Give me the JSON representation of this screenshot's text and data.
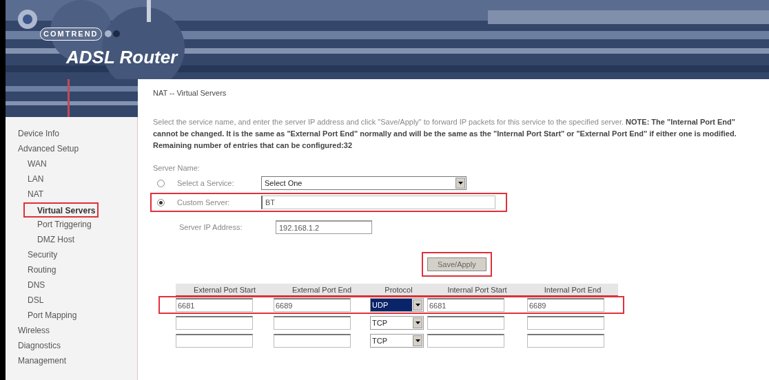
{
  "header": {
    "brand": "COMTREND",
    "product": "ADSL Router"
  },
  "sidebar": {
    "items": [
      {
        "label": "Device Info",
        "selected": false,
        "highlighted": false
      },
      {
        "label": "Advanced Setup",
        "selected": false,
        "highlighted": false,
        "children": [
          {
            "label": "WAN",
            "selected": false,
            "highlighted": false
          },
          {
            "label": "LAN",
            "selected": false,
            "highlighted": false
          },
          {
            "label": "NAT",
            "selected": false,
            "highlighted": false,
            "children": [
              {
                "label": "Virtual Servers",
                "selected": true,
                "highlighted": true
              },
              {
                "label": "Port Triggering",
                "selected": false,
                "highlighted": false
              },
              {
                "label": "DMZ Host",
                "selected": false,
                "highlighted": false
              }
            ]
          },
          {
            "label": "Security",
            "selected": false,
            "highlighted": false
          },
          {
            "label": "Routing",
            "selected": false,
            "highlighted": false
          },
          {
            "label": "DNS",
            "selected": false,
            "highlighted": false
          },
          {
            "label": "DSL",
            "selected": false,
            "highlighted": false
          },
          {
            "label": "Port Mapping",
            "selected": false,
            "highlighted": false
          }
        ]
      },
      {
        "label": "Wireless",
        "selected": false,
        "highlighted": false
      },
      {
        "label": "Diagnostics",
        "selected": false,
        "highlighted": false
      },
      {
        "label": "Management",
        "selected": false,
        "highlighted": false
      }
    ]
  },
  "page": {
    "title": "NAT -- Virtual Servers",
    "description": "Select the service name, and enter the server IP address and click \"Save/Apply\" to forward IP packets for this service to the specified server. **NOTE: The \"Internal Port End\" cannot be changed. It is the same as \"External Port End\" normally and will be the same as the \"Internal Port Start\" or \"External Port End\" if either one is modified.**",
    "remaining": "Remaining number of entries that can be configured:32"
  },
  "form": {
    "section_label": "Server Name:",
    "options": [
      {
        "kind": "select",
        "label": "Select a Service:",
        "value": "Select One",
        "selected": false,
        "highlighted": false
      },
      {
        "kind": "text",
        "label": "Custom Server:",
        "value": "BT",
        "selected": true,
        "highlighted": true
      }
    ],
    "ip": {
      "label": "Server IP Address:",
      "value": "192.168.1.2"
    }
  },
  "save_button": {
    "label": "Save/Apply",
    "highlighted": true
  },
  "table": {
    "columns": [
      "External Port Start",
      "External Port End",
      "Protocol",
      "Internal Port Start",
      "Internal Port End"
    ],
    "rows": [
      {
        "external_start": "6681",
        "external_end": "6689",
        "protocol": "UDP",
        "protocol_selected": true,
        "internal_start": "6681",
        "internal_end": "6689",
        "highlighted": true
      },
      {
        "protocol": "TCP",
        "protocol_selected": false,
        "highlighted": false
      },
      {
        "protocol": "TCP",
        "protocol_selected": false,
        "highlighted": false
      }
    ]
  }
}
